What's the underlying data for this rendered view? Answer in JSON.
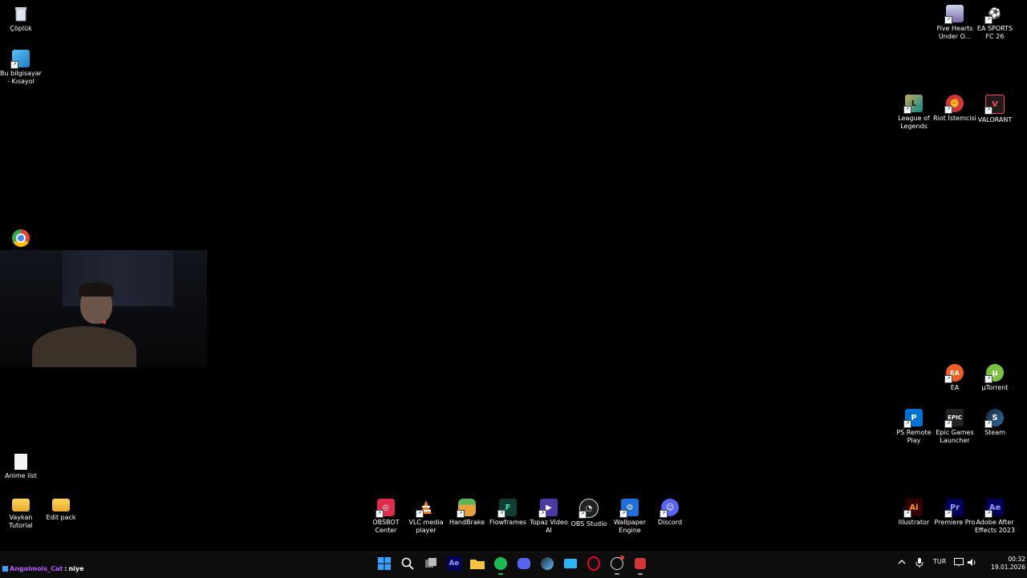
{
  "desktop_left": {
    "recycle_bin": "Çöplük",
    "this_pc": "Bu bilgisayar - Kısayol",
    "anime_list": "Anime list",
    "vaykan": "Vaykan Tutorial",
    "edit_pack": "Edit pack"
  },
  "desktop_right": {
    "five_hearts": "Five Hearts Under O...",
    "ea_fc": "EA SPORTS FC 26",
    "lol": "League of Legends",
    "riot": "Riot İstemcisi",
    "valorant": "VALORANT",
    "ea": "EA",
    "utorrent": "µTorrent",
    "ps_remote": "PS Remote Play",
    "epic": "Epic Games Launcher",
    "steam": "Steam",
    "illustrator": "Illustrator",
    "premiere": "Premiere Pro",
    "after_effects": "Adobe After Effects 2023"
  },
  "desktop_bottom": {
    "obsbot": "OBSBOT Center",
    "vlc": "VLC media player",
    "handbrake": "HandBrake",
    "flowframes": "Flowframes",
    "topaz": "Topaz Video AI",
    "obs": "OBS Studio",
    "wallpaper": "Wallpaper Engine",
    "discord": "Discord"
  },
  "chat": {
    "user": "Angolmois_Cat",
    "separator": ":",
    "text": "niye"
  },
  "taskbar": {
    "language": "TUR",
    "time": "00:32",
    "date": "19.01.2026"
  },
  "colors": {
    "chat_user": "#b35cff",
    "windows_blue": "#3aa0ff",
    "spotify": "#1db954",
    "discord": "#5865f2"
  }
}
